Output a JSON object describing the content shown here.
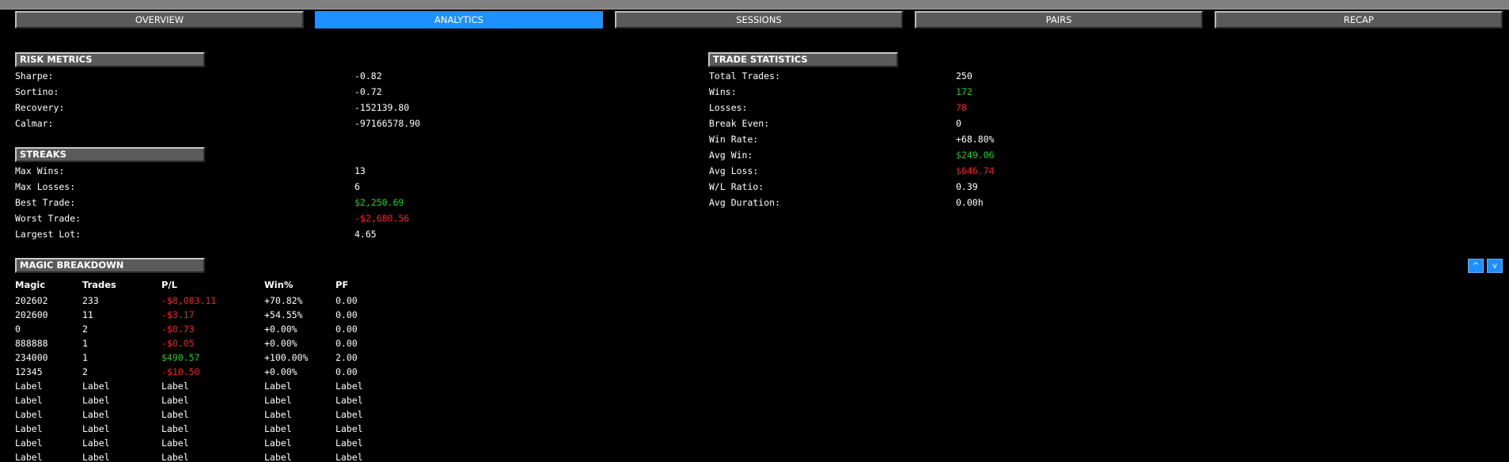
{
  "tabs": [
    {
      "label": "OVERVIEW",
      "active": false
    },
    {
      "label": "ANALYTICS",
      "active": true
    },
    {
      "label": "SESSIONS",
      "active": false
    },
    {
      "label": "PAIRS",
      "active": false
    },
    {
      "label": "RECAP",
      "active": false
    }
  ],
  "risk_metrics": {
    "title": "RISK METRICS",
    "rows": [
      {
        "label": "Sharpe:",
        "value": "-0.82"
      },
      {
        "label": "Sortino:",
        "value": "-0.72"
      },
      {
        "label": "Recovery:",
        "value": "-152139.80"
      },
      {
        "label": "Calmar:",
        "value": "-97166578.90"
      }
    ]
  },
  "streaks": {
    "title": "STREAKS",
    "rows": [
      {
        "label": "Max Wins:",
        "value": "13",
        "tone": "neutral"
      },
      {
        "label": "Max Losses:",
        "value": "6",
        "tone": "neutral"
      },
      {
        "label": "Best Trade:",
        "value": "$2,250.69",
        "tone": "positive"
      },
      {
        "label": "Worst Trade:",
        "value": "-$2,680.56",
        "tone": "negative"
      },
      {
        "label": "Largest Lot:",
        "value": "4.65",
        "tone": "neutral"
      }
    ]
  },
  "trade_statistics": {
    "title": "TRADE STATISTICS",
    "rows": [
      {
        "label": "Total Trades:",
        "value": "250",
        "tone": "neutral"
      },
      {
        "label": "Wins:",
        "value": "172",
        "tone": "positive"
      },
      {
        "label": "Losses:",
        "value": "78",
        "tone": "negative"
      },
      {
        "label": "Break Even:",
        "value": "0",
        "tone": "neutral"
      },
      {
        "label": "Win Rate:",
        "value": "+68.80%",
        "tone": "neutral"
      },
      {
        "label": "Avg Win:",
        "value": "$249.06",
        "tone": "positive"
      },
      {
        "label": "Avg Loss:",
        "value": "$646.74",
        "tone": "negative"
      },
      {
        "label": "W/L Ratio:",
        "value": "0.39",
        "tone": "neutral"
      },
      {
        "label": "Avg Duration:",
        "value": "0.00h",
        "tone": "neutral"
      }
    ]
  },
  "magic_breakdown": {
    "title": "MAGIC BREAKDOWN",
    "columns": [
      "Magic",
      "Trades",
      "P/L",
      "Win%",
      "PF"
    ],
    "rows": [
      {
        "magic": "202602",
        "trades": "233",
        "pl": "-$8,083.11",
        "pl_tone": "negative",
        "win": "+70.82%",
        "pf": "0.00"
      },
      {
        "magic": "202600",
        "trades": "11",
        "pl": "-$3.17",
        "pl_tone": "negative",
        "win": "+54.55%",
        "pf": "0.00"
      },
      {
        "magic": "0",
        "trades": "2",
        "pl": "-$0.73",
        "pl_tone": "negative",
        "win": "+0.00%",
        "pf": "0.00"
      },
      {
        "magic": "888888",
        "trades": "1",
        "pl": "-$0.05",
        "pl_tone": "negative",
        "win": "+0.00%",
        "pf": "0.00"
      },
      {
        "magic": "234000",
        "trades": "1",
        "pl": "$490.57",
        "pl_tone": "positive",
        "win": "+100.00%",
        "pf": "2.00"
      },
      {
        "magic": "12345",
        "trades": "2",
        "pl": "-$10.50",
        "pl_tone": "negative",
        "win": "+0.00%",
        "pf": "0.00"
      },
      {
        "magic": "Label",
        "trades": "Label",
        "pl": "Label",
        "pl_tone": "neutral",
        "win": "Label",
        "pf": "Label"
      },
      {
        "magic": "Label",
        "trades": "Label",
        "pl": "Label",
        "pl_tone": "neutral",
        "win": "Label",
        "pf": "Label"
      },
      {
        "magic": "Label",
        "trades": "Label",
        "pl": "Label",
        "pl_tone": "neutral",
        "win": "Label",
        "pf": "Label"
      },
      {
        "magic": "Label",
        "trades": "Label",
        "pl": "Label",
        "pl_tone": "neutral",
        "win": "Label",
        "pf": "Label"
      },
      {
        "magic": "Label",
        "trades": "Label",
        "pl": "Label",
        "pl_tone": "neutral",
        "win": "Label",
        "pf": "Label"
      },
      {
        "magic": "Label",
        "trades": "Label",
        "pl": "Label",
        "pl_tone": "neutral",
        "win": "Label",
        "pf": "Label"
      }
    ]
  },
  "scroll": {
    "up_label": "^",
    "down_label": "v"
  },
  "colors": {
    "accent": "#1e90ff",
    "positive": "#00dd00",
    "negative": "#ff1a1a",
    "panel": "#5a5a5a",
    "background": "#000000"
  }
}
